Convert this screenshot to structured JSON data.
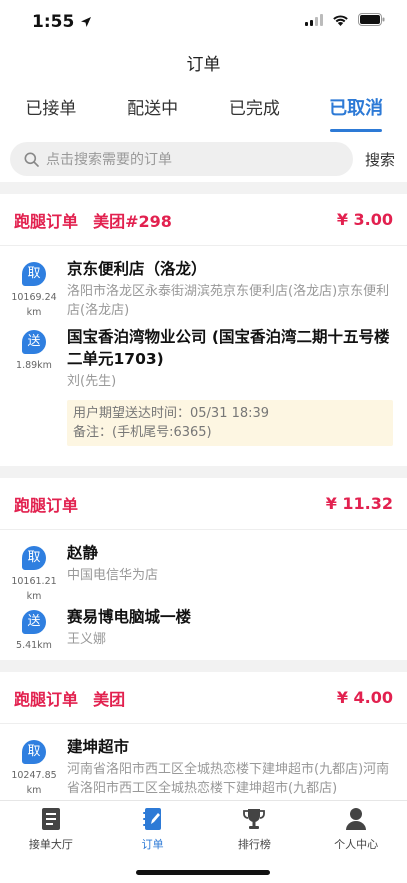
{
  "status": {
    "time": "1:55"
  },
  "nav": {
    "title": "订单"
  },
  "tabs": [
    "已接单",
    "配送中",
    "已完成",
    "已取消"
  ],
  "search": {
    "placeholder": "点击搜索需要的订单",
    "button": "搜索"
  },
  "orders": [
    {
      "type": "跑腿订单",
      "source": "美团#298",
      "price": "¥ 3.00",
      "pickup": {
        "badge": "取",
        "distance": "10169.24km",
        "name": "京东便利店（洛龙）",
        "address": "洛阳市洛龙区永泰街湖滨苑京东便利店(洛龙店)京东便利店(洛龙店)"
      },
      "dropoff": {
        "badge": "送",
        "distance": "1.89km",
        "name": "国宝香泊湾物业公司 (国宝香泊湾二期十五号楼二单元1703)",
        "contact": "刘(先生)"
      },
      "note": {
        "expected": "用户期望送达时间：05/31 18:39",
        "remark": "备注：(手机尾号:6365)"
      }
    },
    {
      "type": "跑腿订单",
      "source": "",
      "price": "¥ 11.32",
      "pickup": {
        "badge": "取",
        "distance": "10161.21km",
        "name": "赵静",
        "address": "中国电信华为店"
      },
      "dropoff": {
        "badge": "送",
        "distance": "5.41km",
        "name": "赛易博电脑城一楼",
        "contact": "王义娜"
      }
    },
    {
      "type": "跑腿订单",
      "source": "美团",
      "price": "¥ 4.00",
      "pickup": {
        "badge": "取",
        "distance": "10247.85km",
        "name": "建坤超市",
        "address": "河南省洛阳市西工区全城热恋楼下建坤超市(九都店)河南省洛阳市西工区全城热恋楼下建坤超市(九都店)"
      }
    }
  ],
  "tabbar": [
    {
      "label": "接单大厅",
      "icon": "document-list-icon"
    },
    {
      "label": "订单",
      "icon": "edit-notebook-icon"
    },
    {
      "label": "排行榜",
      "icon": "trophy-icon"
    },
    {
      "label": "个人中心",
      "icon": "person-icon"
    }
  ],
  "colors": {
    "accent": "#2d7ad6",
    "price": "#e2214f",
    "badge": "#2f7fe0",
    "note_bg": "#fdf6e2"
  }
}
